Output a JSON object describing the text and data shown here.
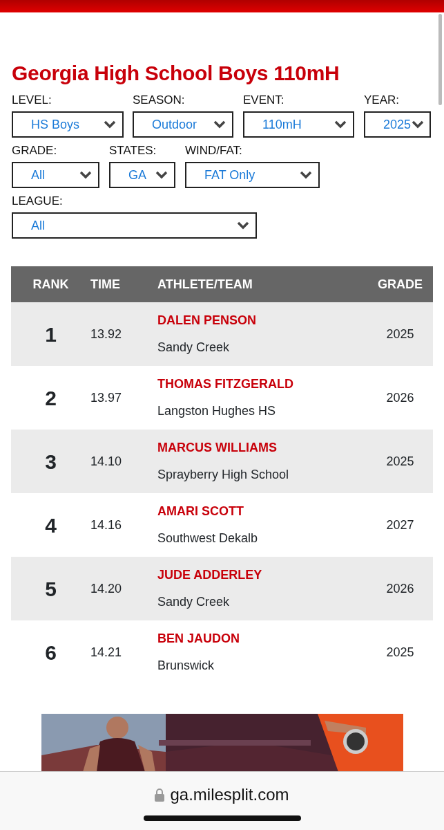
{
  "page_title": "Georgia High School Boys 110mH",
  "filter_rows": [
    [
      {
        "label": "LEVEL:",
        "value": "HS Boys"
      },
      {
        "label": "SEASON:",
        "value": "Outdoor"
      },
      {
        "label": "EVENT:",
        "value": "110mH"
      },
      {
        "label": "YEAR:",
        "value": "2025"
      }
    ],
    [
      {
        "label": "GRADE:",
        "value": "All"
      },
      {
        "label": "STATES:",
        "value": "GA"
      },
      {
        "label": "WIND/FAT:",
        "value": "FAT Only"
      }
    ],
    [
      {
        "label": "LEAGUE:",
        "value": "All"
      }
    ]
  ],
  "table": {
    "columns": [
      "RANK",
      "TIME",
      "ATHLETE/TEAM",
      "GRADE"
    ],
    "rows": [
      {
        "rank": "1",
        "time": "13.92",
        "athlete": "DALEN PENSON",
        "team": "Sandy Creek",
        "grade": "2025"
      },
      {
        "rank": "2",
        "time": "13.97",
        "athlete": "THOMAS FITZGERALD",
        "team": "Langston Hughes HS",
        "grade": "2026"
      },
      {
        "rank": "3",
        "time": "14.10",
        "athlete": "MARCUS WILLIAMS",
        "team": "Sprayberry High School",
        "grade": "2025"
      },
      {
        "rank": "4",
        "time": "14.16",
        "athlete": "AMARI SCOTT",
        "team": "Southwest Dekalb",
        "grade": "2027"
      },
      {
        "rank": "5",
        "time": "14.20",
        "athlete": "JUDE ADDERLEY",
        "team": "Sandy Creek",
        "grade": "2026"
      },
      {
        "rank": "6",
        "time": "14.21",
        "athlete": "BEN JAUDON",
        "team": "Brunswick",
        "grade": "2025"
      }
    ]
  },
  "ad_banner": {
    "kind": "picture"
  },
  "browser_bar": {
    "url": "ga.milesplit.com"
  }
}
